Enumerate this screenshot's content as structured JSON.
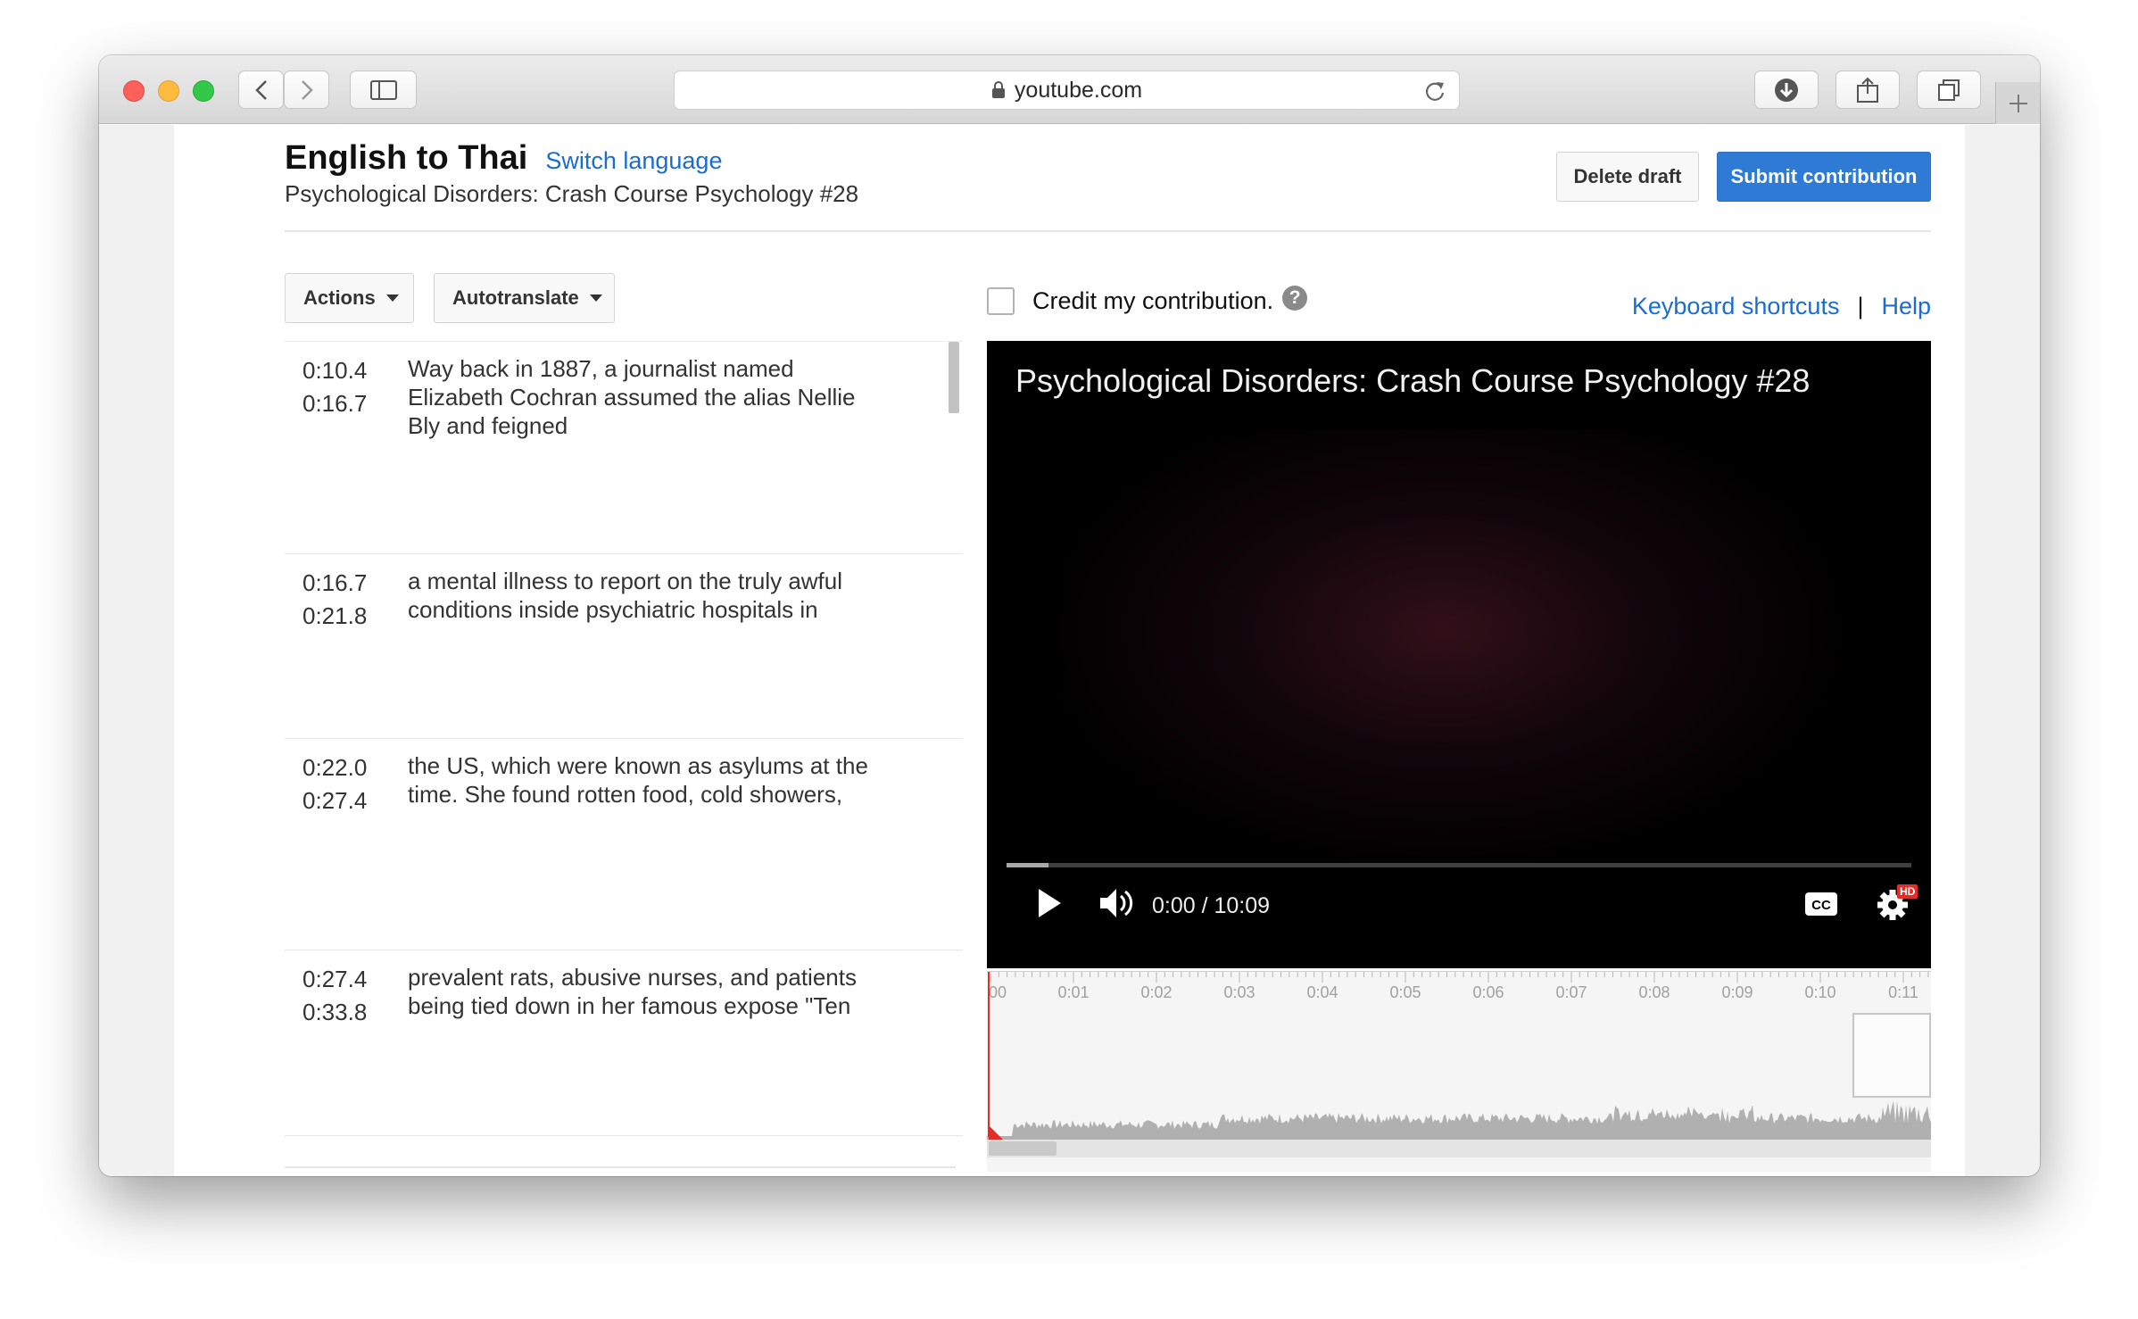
{
  "browser": {
    "url": "youtube.com"
  },
  "header": {
    "title": "English to Thai",
    "switch_language": "Switch language",
    "subtitle": "Psychological Disorders: Crash Course Psychology #28",
    "delete_draft": "Delete draft",
    "submit": "Submit contribution"
  },
  "toolbar": {
    "actions": "Actions",
    "autotranslate": "Autotranslate",
    "credit": "Credit my contribution.",
    "help_mark": "?",
    "keyboard_shortcuts": "Keyboard shortcuts",
    "separator": "|",
    "help": "Help"
  },
  "captions": [
    {
      "start": "0:10.4",
      "end": "0:16.7",
      "text": "Way back in 1887, a journalist named Elizabeth Cochran assumed the alias Nellie Bly and feigned"
    },
    {
      "start": "0:16.7",
      "end": "0:21.8",
      "text": "a mental illness to report on the truly awful conditions inside psychiatric hospitals in"
    },
    {
      "start": "0:22.0",
      "end": "0:27.4",
      "text": "the US, which were known as asylums at the time. She found rotten food, cold showers,"
    },
    {
      "start": "0:27.4",
      "end": "0:33.8",
      "text": "prevalent rats, abusive nurses, and patients being tied down in her famous expose \"Ten"
    }
  ],
  "player": {
    "title": "Psychological Disorders: Crash Course Psychology #28",
    "time": "0:00 / 10:09",
    "cc": "CC",
    "hd": "HD"
  },
  "timeline": {
    "labels": [
      "00",
      "0:01",
      "0:02",
      "0:03",
      "0:04",
      "0:05",
      "0:06",
      "0:07",
      "0:08",
      "0:09",
      "0:10",
      "0:11"
    ]
  },
  "colors": {
    "accent": "#2f7ad4",
    "link": "#1a6dd0",
    "playhead": "#e52d27"
  },
  "icons": [
    "back-icon",
    "forward-icon",
    "sidebar-icon",
    "lock-icon",
    "reload-icon",
    "download-icon",
    "share-icon",
    "tabs-icon",
    "plus-icon",
    "play-icon",
    "volume-icon",
    "cc-icon",
    "gear-icon"
  ]
}
